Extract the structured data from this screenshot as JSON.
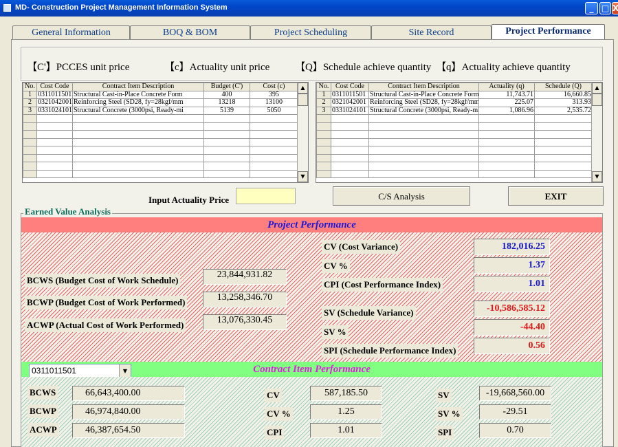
{
  "window": {
    "title": "MD- Construction Project Management Information System",
    "minimize": "_",
    "maximize": "□",
    "close": "X"
  },
  "tabs": [
    "General Information",
    "BOQ & BOM",
    "Project Scheduling",
    "Site Record",
    "Project Performance"
  ],
  "legend": {
    "C_prime": "【C'】PCCES unit price",
    "c": "【c】Actuality unit price",
    "Q": "【Q】Schedule achieve quantity",
    "q": "【q】Actuality achieve quantity"
  },
  "price_grid": {
    "headers": [
      "No.",
      "Cost Code",
      "Contract Item Description",
      "Budget (C')",
      "Cost (c)"
    ],
    "rows": [
      [
        "1",
        "0311011501",
        "Structural Cast-in-Place Concrete Form",
        "400",
        "395"
      ],
      [
        "2",
        "0321042001",
        "Reinforcing Steel (SD28, fy=28kgf/mm",
        "13218",
        "13100"
      ],
      [
        "3",
        "0331024101",
        "Structural Concrete (3000psi, Ready-mi",
        "5139",
        "5050"
      ]
    ]
  },
  "quantity_grid": {
    "headers": [
      "No.",
      "Cost Code",
      "Contract Item Description",
      "Actuality (q)",
      "Schedule (Q)"
    ],
    "rows": [
      [
        "1",
        "0311011501",
        "Structural Cast-in-Place Concrete Form",
        "11,743.71",
        "16,660.85"
      ],
      [
        "2",
        "0321042001",
        "Reinforcing Steel (SD28, fy=28kgf/mm",
        "225.07",
        "313.93"
      ],
      [
        "3",
        "0331024101",
        "Structural Concrete (3000psi, Ready-mi",
        "1,086.96",
        "2,535.72"
      ]
    ]
  },
  "scroll_up": "▲",
  "scroll_down": "▼",
  "input_price": {
    "label": "Input Actuality Price",
    "value": ""
  },
  "buttons": {
    "analysis": "C/S  Analysis",
    "exit": "EXIT"
  },
  "earned_value": {
    "frame_title": "Earned Value Analysis",
    "project_bar": "Project Performance",
    "labels": {
      "cv": "CV (Cost Variance)",
      "cv_pct": "CV %",
      "cpi": "CPI (Cost Performance Index)",
      "sv": "SV (Schedule Variance)",
      "sv_pct": "SV %",
      "spi": "SPI (Schedule Performance Index)",
      "bcws": "BCWS (Budget Cost of Work Schedule)",
      "bcwp": "BCWP (Budget Cost of Work Performed)",
      "acwp": "ACWP (Actual Cost of Work Performed)"
    },
    "values": {
      "cv": "182,016.25",
      "cv_pct": "1.37",
      "cpi": "1.01",
      "sv": "-10,586,585.12",
      "sv_pct": "-44.40",
      "spi": "0.56",
      "bcws": "23,844,931.82",
      "bcwp": "13,258,346.70",
      "acwp": "13,076,330.45"
    },
    "colors": {
      "positive": "#1616d4",
      "negative": "#e01a1a",
      "project_bar": "#ff7f7f",
      "contract_bar": "#80ff80"
    }
  },
  "contract_item": {
    "bar": "Contract Item Performance",
    "selected_code": "0311011501",
    "dropdown_icon": "▼",
    "labels": {
      "bcws": "BCWS",
      "bcwp": "BCWP",
      "acwp": "ACWP",
      "cv": "CV",
      "cv_pct": "CV %",
      "cpi": "CPI",
      "sv": "SV",
      "sv_pct": "SV %",
      "spi": "SPI"
    },
    "values": {
      "bcws": "66,643,400.00",
      "bcwp": "46,974,840.00",
      "acwp": "46,387,654.50",
      "cv": "587,185.50",
      "cv_pct": "1.25",
      "cpi": "1.01",
      "sv": "-19,668,560.00",
      "sv_pct": "-29.51",
      "spi": "0.70"
    }
  }
}
